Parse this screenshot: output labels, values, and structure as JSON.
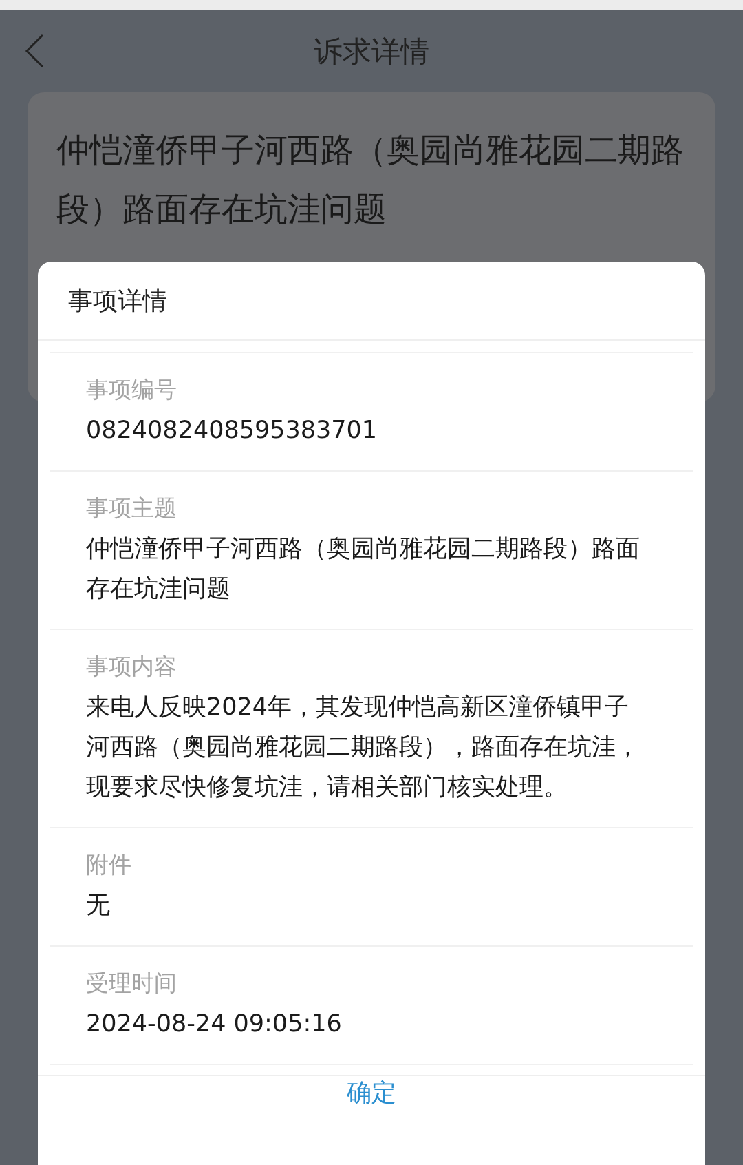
{
  "header": {
    "title": "诉求详情"
  },
  "card": {
    "title": "仲恺潼侨甲子河西路（奥园尚雅花园二期路段）路面存在坑洼问题"
  },
  "dialog": {
    "title": "事项详情",
    "fields": [
      {
        "label": "事项编号",
        "value": "0824082408595383701"
      },
      {
        "label": "事项主题",
        "value": "仲恺潼侨甲子河西路（奥园尚雅花园二期路段）路面存在坑洼问题"
      },
      {
        "label": "事项内容",
        "value": "来电人反映2024年，其发现仲恺高新区潼侨镇甲子河西路（奥园尚雅花园二期路段），路面存在坑洼，现要求尽快修复坑洼，请相关部门核实处理。"
      },
      {
        "label": "附件",
        "value": "无"
      },
      {
        "label": "受理时间",
        "value": "2024-08-24 09:05:16"
      }
    ],
    "confirm": "确定"
  }
}
